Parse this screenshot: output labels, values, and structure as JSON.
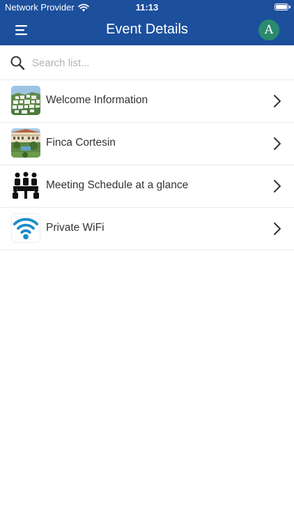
{
  "status_bar": {
    "carrier": "Network Provider",
    "time": "11:13"
  },
  "nav": {
    "title": "Event Details",
    "avatar_initial": "A",
    "menu_icon": "hamburger-icon"
  },
  "search": {
    "placeholder": "Search list...",
    "value": ""
  },
  "items": [
    {
      "label": "Welcome Information",
      "icon": "town-photo-thumbnail"
    },
    {
      "label": "Finca Cortesin",
      "icon": "hotel-photo-thumbnail"
    },
    {
      "label": "Meeting Schedule at a glance",
      "icon": "meeting-people-icon"
    },
    {
      "label": "Private WiFi",
      "icon": "wifi-icon"
    }
  ],
  "colors": {
    "header": "#1c4f9c",
    "avatar": "#2a8a6e",
    "wifi": "#1a8ccc",
    "text": "#333333"
  }
}
